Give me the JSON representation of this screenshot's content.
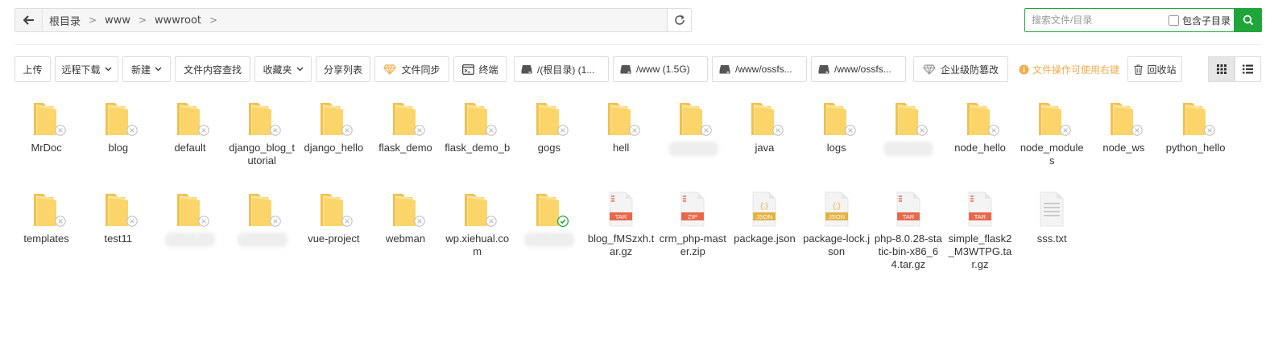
{
  "breadcrumb": [
    "根目录",
    "www",
    "wwwroot"
  ],
  "search": {
    "placeholder": "搜索文件/目录",
    "include_sub_label": "包含子目录"
  },
  "toolbar": {
    "upload": "上传",
    "remote_download": "远程下载",
    "new": "新建",
    "content_search": "文件内容查找",
    "favorites": "收藏夹",
    "share_list": "分享列表",
    "file_sync": "文件同步",
    "terminal": "终端",
    "disks": [
      "/(根目录) (1...",
      "/www (1.5G)",
      "/www/ossfs...",
      "/www/ossfs..."
    ],
    "tamper_proof": "企业级防篡改",
    "notice": "文件操作可使用右键",
    "recycle_bin": "回收站"
  },
  "colors": {
    "accent": "#20a53a",
    "folder": "#fbd56a",
    "folder_dark": "#f2c14e",
    "notice": "#f0ad4e"
  },
  "files": [
    {
      "name": "MrDoc",
      "type": "folder",
      "badge": "lock"
    },
    {
      "name": "blog",
      "type": "folder",
      "badge": "lock"
    },
    {
      "name": "default",
      "type": "folder",
      "badge": "lock"
    },
    {
      "name": "django_blog_tutorial",
      "type": "folder",
      "badge": "lock"
    },
    {
      "name": "django_hello",
      "type": "folder",
      "badge": "lock"
    },
    {
      "name": "flask_demo",
      "type": "folder",
      "badge": "lock"
    },
    {
      "name": "flask_demo_b",
      "type": "folder",
      "badge": "lock"
    },
    {
      "name": "gogs",
      "type": "folder",
      "badge": "lock"
    },
    {
      "name": "hell",
      "type": "folder",
      "badge": "lock"
    },
    {
      "name": "in com",
      "type": "folder",
      "badge": "lock",
      "redacted": true
    },
    {
      "name": "java",
      "type": "folder",
      "badge": "lock"
    },
    {
      "name": "logs",
      "type": "folder",
      "badge": "lock"
    },
    {
      "name": "ua l.com",
      "type": "folder",
      "badge": "lock",
      "redacted": true
    },
    {
      "name": "node_hello",
      "type": "folder",
      "badge": "lock"
    },
    {
      "name": "node_modules",
      "type": "folder",
      "badge": "lock"
    },
    {
      "name": "node_ws",
      "type": "folder",
      "badge": "lock"
    },
    {
      "name": "python_hello",
      "type": "folder",
      "badge": "lock"
    },
    {
      "name": "templates",
      "type": "folder",
      "badge": "lock"
    },
    {
      "name": "test11",
      "type": "folder",
      "badge": "lock"
    },
    {
      "name": "ieh",
      "type": "folder",
      "badge": "lock",
      "redacted": true
    },
    {
      "name": "com",
      "type": "folder",
      "badge": "lock",
      "redacted": true
    },
    {
      "name": "vue-project",
      "type": "folder",
      "badge": "lock"
    },
    {
      "name": "webman",
      "type": "folder",
      "badge": "lock"
    },
    {
      "name": "wp.xiehual.com",
      "type": "folder",
      "badge": "lock"
    },
    {
      "name": "ww l.com",
      "type": "folder",
      "badge": "shield",
      "redacted": true
    },
    {
      "name": "blog_fMSzxh.tar.gz",
      "type": "tar"
    },
    {
      "name": "crm_php-master.zip",
      "type": "zip"
    },
    {
      "name": "package.json",
      "type": "json"
    },
    {
      "name": "package-lock.json",
      "type": "json"
    },
    {
      "name": "php-8.0.28-static-bin-x86_64.tar.gz",
      "type": "tar"
    },
    {
      "name": "simple_flask2_M3WTPG.tar.gz",
      "type": "tar"
    },
    {
      "name": "sss.txt",
      "type": "txt"
    }
  ]
}
